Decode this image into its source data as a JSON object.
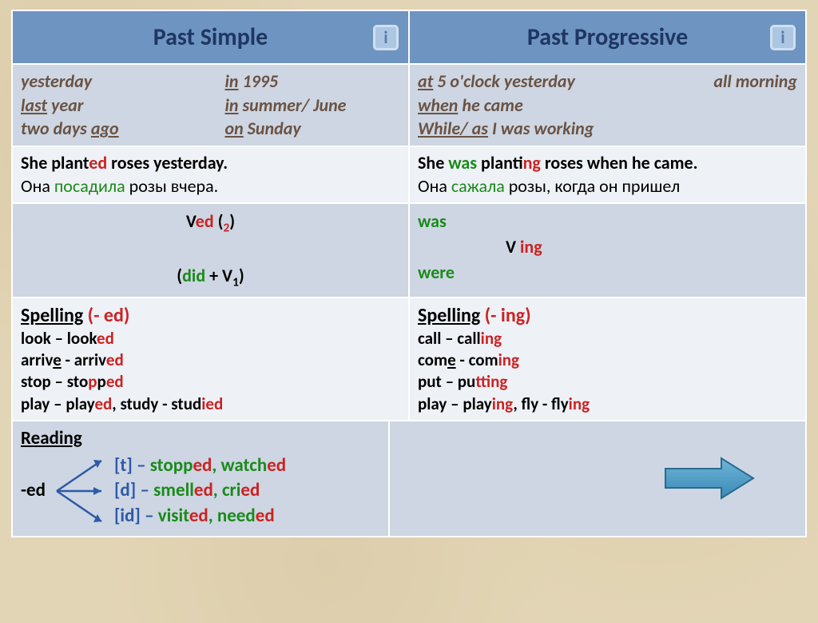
{
  "header": {
    "left": "Past Simple",
    "right": "Past Progressive",
    "info": "i"
  },
  "time": {
    "left": {
      "c1a": "yesterday",
      "c1b_pre": "last",
      "c1b_word": " year",
      "c1c_pre": "two days ",
      "c1c_word": "ago",
      "c2a_pre": "in",
      "c2a_word": " 1995",
      "c2b_pre": "in",
      "c2b_word": " summer/ June",
      "c2c_pre": "on",
      "c2c_word": " Sunday"
    },
    "right": {
      "l1a_pre": "at",
      "l1a_word": " 5 o'clock  yesterday",
      "l1b": "all morning",
      "l2_pre": "when",
      "l2_word": " he came",
      "l3_pre": "While/ as",
      "l3_word": " I was working"
    }
  },
  "example": {
    "left_en_pre": "She  plant",
    "left_en_ed": "ed",
    "left_en_post": " roses yesterday.",
    "left_ru_pre": "Она ",
    "left_ru_verb": "посадила",
    "left_ru_post": " розы вчера.",
    "right_en_pre": "She ",
    "right_en_was": "was",
    "right_en_mid": " plant",
    "right_en_ing": "ing",
    "right_en_post": " roses when he came.",
    "right_ru_pre": "Она ",
    "right_ru_verb": "сажала",
    "right_ru_post": " розы, когда он пришел"
  },
  "formula": {
    "left_l1_pre": "V",
    "left_l1_ed": "ed",
    "left_l1_post": " (",
    "left_l1_num": "2",
    "left_l1_close": ")",
    "left_l2_pre": "(",
    "left_l2_did": "did",
    "left_l2_post": " + V",
    "left_l2_num": "1",
    "left_l2_close": ")",
    "right_was": "was",
    "right_v": "V ",
    "right_ing": "ing",
    "right_were": "were"
  },
  "spelling": {
    "left_title_word": "Spelling",
    "left_title_suffix": "  (- ed)",
    "left_l1_pre": "look – look",
    "left_l1_ed": "ed",
    "left_l2_pre": "arriv",
    "left_l2_u": "e",
    "left_l2_mid": " - arriv",
    "left_l2_ed": "ed",
    "left_l3_pre": "stop – sto",
    "left_l3_p": "p",
    "left_l3_mid": "p",
    "left_l3_ed": "ed",
    "left_l4_pre": "play – play",
    "left_l4_ed": "ed",
    "left_l4_mid": ", study - stud",
    "left_l4_i": "i",
    "left_l4_ed2": "ed",
    "right_title_word": "Spelling",
    "right_title_suffix": "  (- ing)",
    "right_l1_pre": "call – call",
    "right_l1_ing": "ing",
    "right_l2_pre": "com",
    "right_l2_u": "e",
    "right_l2_mid": " - com",
    "right_l2_ing": "ing",
    "right_l3_pre": "put – pu",
    "right_l3_t": "t",
    "right_l3_mid": "t",
    "right_l3_ing": "ing",
    "right_l4_pre": "play – play",
    "right_l4_ing": "ing",
    "right_l4_mid": ", fly - fly",
    "right_l4_ing2": "ing"
  },
  "reading": {
    "title": "Reading",
    "ed_label": "-ed",
    "l1_br": "[t] – ",
    "l1_w1": "stopp",
    "l1_ed1": "ed",
    "l1_sep": ", ",
    "l1_w2": "watch",
    "l1_ed2": "ed",
    "l2_br": "[d] – ",
    "l2_w1": "smell",
    "l2_ed1": "ed",
    "l2_sep": ", ",
    "l2_w2": "cri",
    "l2_ed2": "ed",
    "l3_br": "[id] – ",
    "l3_w1": "visit",
    "l3_ed1": "ed",
    "l3_sep": ", ",
    "l3_w2": "need",
    "l3_ed2": "ed"
  }
}
